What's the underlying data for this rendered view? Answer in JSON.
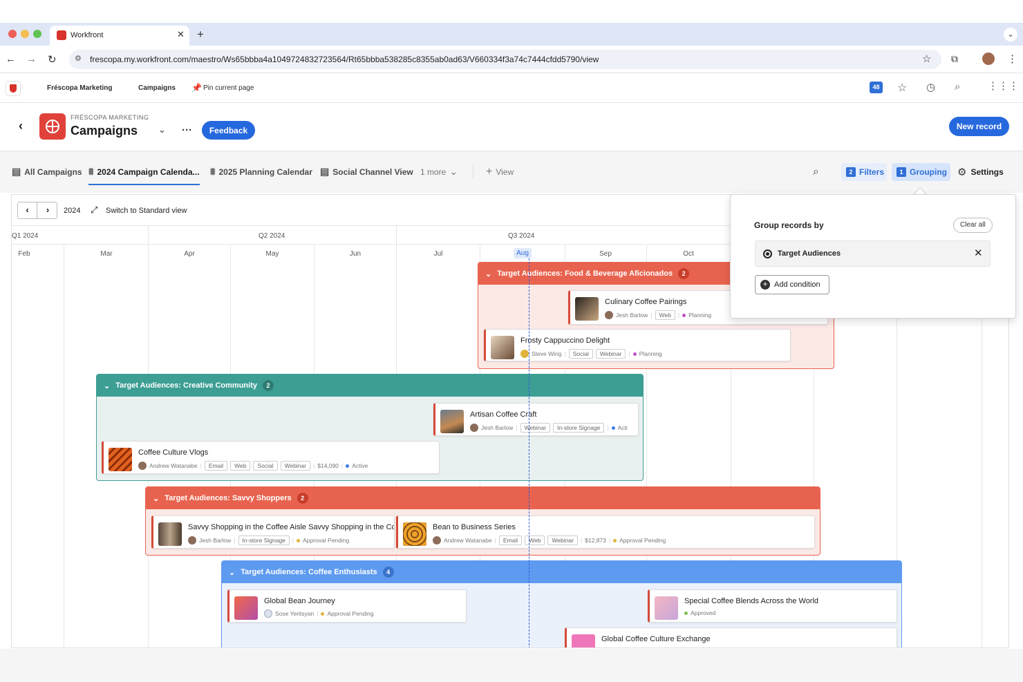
{
  "browser": {
    "tab_title": "Workfront",
    "url": "frescopa.my.workfront.com/maestro/Ws65bbba4a1049724832723564/Rt65bbba538285c8355ab0ad63/V660334f3a74c7444cfdd5790/view"
  },
  "app_header": {
    "org": "Fréscopa Marketing",
    "campaigns": "Campaigns",
    "pin": "Pin current page",
    "notif_count": "48"
  },
  "page": {
    "eyebrow": "FRÉSCOPA MARKETING",
    "title": "Campaigns",
    "feedback": "Feedback",
    "new_record": "New record"
  },
  "views": {
    "tabs": [
      "All Campaigns",
      "2024 Campaign Calenda...",
      "2025 Planning Calendar",
      "Social Channel View"
    ],
    "more": "1 more",
    "add_view": "View",
    "filters_count": "2",
    "filters": "Filters",
    "grouping_count": "1",
    "grouping": "Grouping",
    "settings": "Settings"
  },
  "toolbar": {
    "year": "2024",
    "switch": "Switch to Standard view"
  },
  "timeline": {
    "quarters": [
      "Q1 2024",
      "Q2 2024",
      "Q3 2024"
    ],
    "months": [
      "Feb",
      "Mar",
      "Apr",
      "May",
      "Jun",
      "Jul",
      "Aug",
      "Sep",
      "Oct"
    ]
  },
  "groups": [
    {
      "label": "Target Audiences: Food & Beverage Aficionados",
      "count": "2",
      "color": "#e8634f",
      "records": [
        {
          "title": "Culinary Coffee Pairings",
          "owner": "Jesh Barlow",
          "tags": [
            "Web"
          ],
          "status": "Planning",
          "status_color": "#c04fc8"
        },
        {
          "title": "Frosty Cappuccino Delight",
          "owner": "Steve Wirig",
          "tags": [
            "Social",
            "Webinar"
          ],
          "status": "Planning",
          "status_color": "#c04fc8"
        }
      ]
    },
    {
      "label": "Target Audiences: Creative Community",
      "count": "2",
      "color": "#3d9e94",
      "records": [
        {
          "title": "Artisan Coffee Craft",
          "owner": "Jesh Barlow",
          "tags": [
            "Webinar",
            "In-store Signage"
          ],
          "status": "Acti",
          "status_color": "#3b7be0"
        },
        {
          "title": "Coffee Culture Vlogs",
          "owner": "Andrew Watanabe",
          "tags": [
            "Email",
            "Web",
            "Social",
            "Webinar"
          ],
          "budget": "$14,090",
          "status": "Active",
          "status_color": "#3b7be0"
        }
      ]
    },
    {
      "label": "Target Audiences: Savvy Shoppers",
      "count": "2",
      "color": "#e8634f",
      "records": [
        {
          "title": "Savvy Shopping in the Coffee Aisle Savvy Shopping in the Cof",
          "owner": "Jesh Barlow",
          "tags": [
            "In-store Signage"
          ],
          "status": "Approval Pending",
          "status_color": "#e0b43b"
        },
        {
          "title": "Bean to Business Series",
          "owner": "Andrew Watanabe",
          "tags": [
            "Email",
            "Web",
            "Webinar"
          ],
          "budget": "$12,873",
          "status": "Approval Pending",
          "status_color": "#e0b43b"
        }
      ]
    },
    {
      "label": "Target Audiences: Coffee Enthusiasts",
      "count": "4",
      "color": "#5e9af0",
      "records": [
        {
          "title": "Global Bean Journey",
          "owner": "Sose Yeritsyan",
          "status": "Approval Pending",
          "status_color": "#e0b43b"
        },
        {
          "title": "Special Coffee Blends Across the World",
          "status": "Approved",
          "status_color": "#7cc04a"
        },
        {
          "title": "Global Coffee Culture Exchange"
        }
      ]
    }
  ],
  "grouping_panel": {
    "title": "Group records by",
    "clear_all": "Clear all",
    "field": "Target Audiences",
    "add_condition": "Add condition"
  }
}
